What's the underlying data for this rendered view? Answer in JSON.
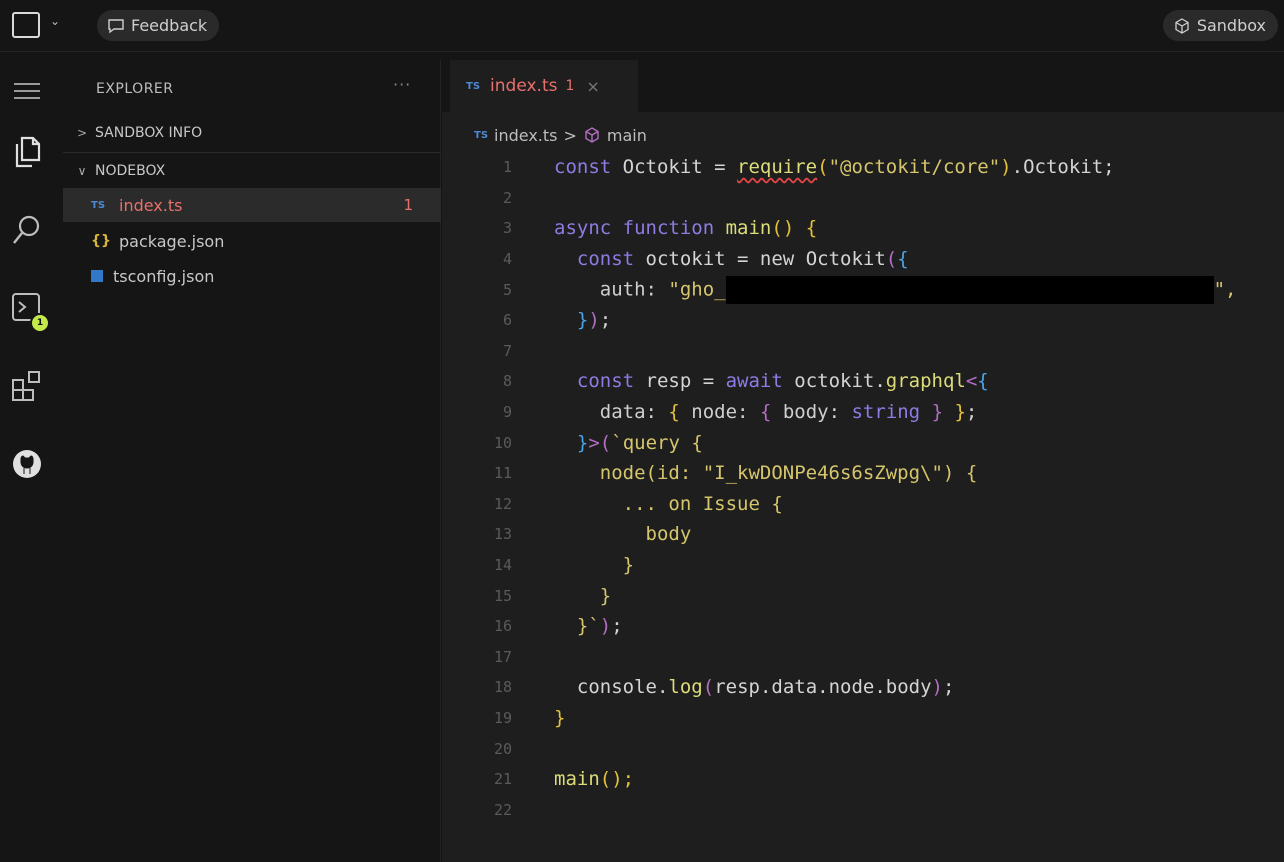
{
  "topbar": {
    "feedback_label": "Feedback",
    "sandbox_label": "Sandbox",
    "menu_chevron": "⌄"
  },
  "activity": {
    "terminal_badge": "1"
  },
  "sidebar": {
    "title": "EXPLORER",
    "more": "···",
    "sections": [
      {
        "label": "SANDBOX INFO",
        "expanded": false
      },
      {
        "label": "NODEBOX",
        "expanded": true
      }
    ],
    "files": [
      {
        "icon": "TS",
        "name": "index.ts",
        "problems": "1",
        "active": true
      },
      {
        "icon": "{}",
        "name": "package.json"
      },
      {
        "icon": "tsconfig-icon",
        "name": "tsconfig.json"
      }
    ]
  },
  "editor": {
    "tab": {
      "icon": "TS",
      "name": "index.ts",
      "problems": "1",
      "close": "×"
    },
    "breadcrumb": {
      "file_icon": "TS",
      "file": "index.ts",
      "separator": ">",
      "symbol": "main"
    },
    "line_numbers": [
      "1",
      "2",
      "3",
      "4",
      "5",
      "6",
      "7",
      "8",
      "9",
      "10",
      "11",
      "12",
      "13",
      "14",
      "15",
      "16",
      "17",
      "18",
      "19",
      "20",
      "21",
      "22"
    ],
    "code": {
      "l1_const": "const",
      "l1_var": " Octokit = ",
      "l1_require": "require",
      "l1_str": "\"@octokit/core\"",
      "l1_tail": ".Octokit;",
      "l3_async": "async function",
      "l3_main": "main",
      "l3_paren": "() ",
      "l4_const": "const",
      "l4_mid": " octokit = new ",
      "l4_cls": "Octokit",
      "l5_auth": "auth: ",
      "l5_str": "\"gho_",
      "l5_end": "\",",
      "l6_end": ");",
      "l8_const": "const",
      "l8_mid": " resp = ",
      "l8_await": "await",
      "l8_obj": " octokit.",
      "l8_fn": "graphql",
      "l9_data": "data: ",
      "l9_node": " node: ",
      "l9_body": " body: ",
      "l9_type": "string",
      "l10_q": "`query ",
      "l11_str": "node(id: \"I_kwDONPe46s6sZwpg\\\") ",
      "l12_str": "... on Issue ",
      "l13_str": "body",
      "l16_tick": "`",
      "l18_a": "console.",
      "l18_fn": "log",
      "l18_b": "resp.data.node.body",
      "l21_fn": "main",
      "l21_b": "();"
    }
  },
  "colors": {
    "accent_badge": "#c3e94a",
    "error": "#e8706c",
    "ts_blue": "#4e88d4"
  }
}
